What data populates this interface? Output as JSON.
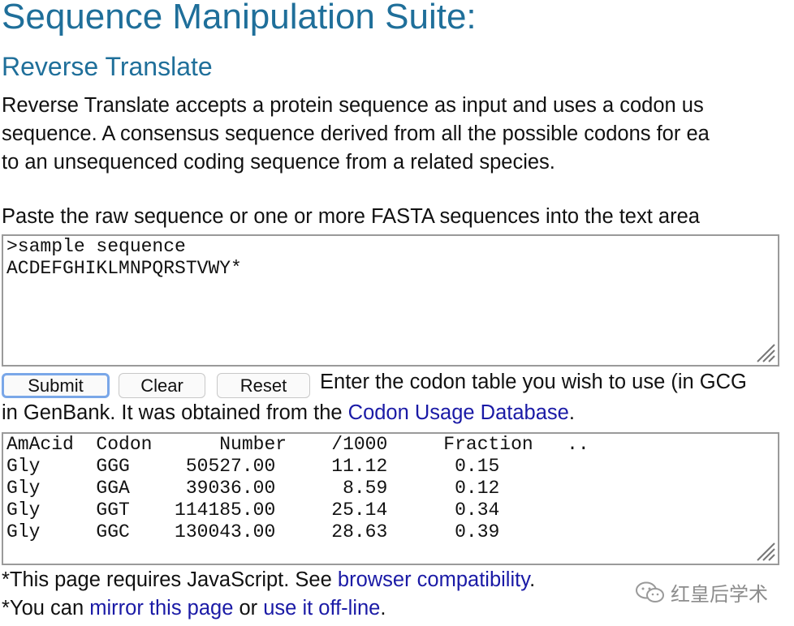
{
  "header": {
    "title": "Sequence Manipulation Suite:",
    "subtitle": "Reverse Translate"
  },
  "description": {
    "line1": "Reverse Translate accepts a protein sequence as input and uses a codon us",
    "line2": "sequence. A consensus sequence derived from all the possible codons for ea",
    "line3": "to an unsequenced coding sequence from a related species."
  },
  "sequence_input": {
    "instruction": "Paste the raw sequence or one or more FASTA sequences into the text area",
    "lines": [
      ">sample sequence",
      "ACDEFGHIKLMNPQRSTVWY*"
    ]
  },
  "buttons": {
    "submit": "Submit",
    "clear": "Clear",
    "reset": "Reset"
  },
  "codon_table": {
    "instruction": "Enter the codon table you wish to use (in GCG",
    "source_prefix": "in GenBank. It was obtained from the ",
    "source_link": "Codon Usage Database",
    "source_suffix": ".",
    "lines": [
      "AmAcid  Codon      Number    /1000     Fraction   ..",
      "",
      "Gly     GGG     50527.00     11.12      0.15",
      "Gly     GGA     39036.00      8.59      0.12",
      "Gly     GGT    114185.00     25.14      0.34",
      "Gly     GGC    130043.00     28.63      0.39"
    ]
  },
  "footer": {
    "js_note_prefix": "*This page requires JavaScript. See ",
    "js_note_link": "browser compatibility",
    "js_note_suffix": ".",
    "mirror_prefix": "*You can ",
    "mirror_link": "mirror this page",
    "mirror_middle": " or ",
    "offline_link": "use it off-line",
    "mirror_suffix": "."
  },
  "watermark": {
    "text": "红皇后学术",
    "icon": "wechat-icon"
  },
  "colors": {
    "heading": "#1f6f9a",
    "link": "#1a1aa6",
    "focus_ring": "#7aa7e8"
  }
}
